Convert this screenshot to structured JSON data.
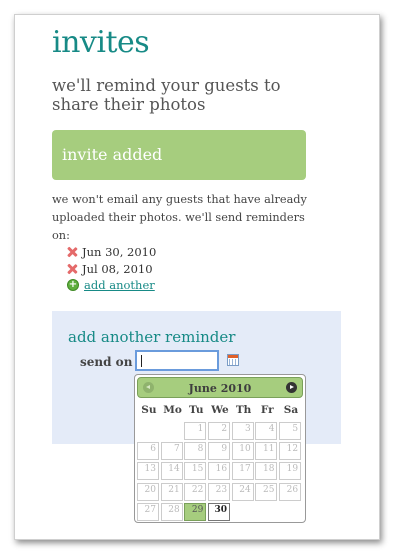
{
  "header": {
    "title": "invites",
    "subtitle": "we'll remind your guests to share their photos"
  },
  "banner": {
    "text": "invite added"
  },
  "info": {
    "text": "we won't email any guests that have already uploaded their photos. we'll send reminders on:"
  },
  "reminders": [
    {
      "date": "Jun 30, 2010",
      "icon": "remove-x-icon"
    },
    {
      "date": "Jul 08, 2010",
      "icon": "remove-x-icon"
    }
  ],
  "add_link": {
    "label": "add another",
    "icon": "add-plus-icon"
  },
  "panel": {
    "title": "add another reminder",
    "send_label": "send on",
    "input_value": ""
  },
  "datepicker": {
    "month": "June 2010",
    "weekdays": [
      "Su",
      "Mo",
      "Tu",
      "We",
      "Th",
      "Fr",
      "Sa"
    ],
    "weeks": [
      [
        "",
        "",
        "1",
        "2",
        "3",
        "4",
        "5"
      ],
      [
        "6",
        "7",
        "8",
        "9",
        "10",
        "11",
        "12"
      ],
      [
        "13",
        "14",
        "15",
        "16",
        "17",
        "18",
        "19"
      ],
      [
        "20",
        "21",
        "22",
        "23",
        "24",
        "25",
        "26"
      ],
      [
        "27",
        "28",
        "29",
        "30",
        "",
        "",
        ""
      ]
    ],
    "today": "29",
    "selectable": [
      "30"
    ]
  },
  "colors": {
    "accent": "#178a86",
    "banner": "#a6cd7e",
    "panel": "#e4ebf8"
  }
}
